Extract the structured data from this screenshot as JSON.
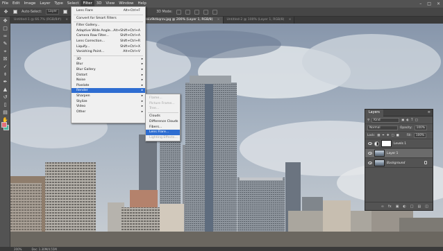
{
  "menubar": {
    "items": [
      "File",
      "Edit",
      "Image",
      "Layer",
      "Type",
      "Select",
      "Filter",
      "3D",
      "View",
      "Window",
      "Help"
    ],
    "active_index": 6
  },
  "options": {
    "auto_select_label": "Auto-Select:",
    "auto_select_value": "Layer",
    "mode_label": "3D Mode:"
  },
  "tabs": [
    {
      "label": "Untitled-1 @ 66.7% (RGB/8#)",
      "active": false
    },
    {
      "label": "Untitled-4 @ 25% (RGB/8)",
      "active": false
    },
    {
      "label": "ndh9ywyzeix9ktkqrzv.jpg @ 200% (Layer 1, RGB/8)",
      "active": true
    },
    {
      "label": "Untitled-2 @ 100% (Layer 1, RGB/8)",
      "active": false
    }
  ],
  "filter_menu": {
    "items": [
      {
        "label": "Lens Flare",
        "shortcut": "Alt+Ctrl+F",
        "sub": false
      },
      {
        "sep": true
      },
      {
        "label": "Convert for Smart Filters",
        "shortcut": "",
        "sub": false
      },
      {
        "sep": true
      },
      {
        "label": "Filter Gallery...",
        "shortcut": "",
        "sub": false
      },
      {
        "label": "Adaptive Wide Angle...",
        "shortcut": "Alt+Shift+Ctrl+A",
        "sub": false
      },
      {
        "label": "Camera Raw Filter...",
        "shortcut": "Shift+Ctrl+A",
        "sub": false
      },
      {
        "label": "Lens Correction...",
        "shortcut": "Shift+Ctrl+R",
        "sub": false
      },
      {
        "label": "Liquify...",
        "shortcut": "Shift+Ctrl+X",
        "sub": false
      },
      {
        "label": "Vanishing Point...",
        "shortcut": "Alt+Ctrl+V",
        "sub": false
      },
      {
        "sep": true
      },
      {
        "label": "3D",
        "shortcut": "",
        "sub": true
      },
      {
        "label": "Blur",
        "shortcut": "",
        "sub": true
      },
      {
        "label": "Blur Gallery",
        "shortcut": "",
        "sub": true
      },
      {
        "label": "Distort",
        "shortcut": "",
        "sub": true
      },
      {
        "label": "Noise",
        "shortcut": "",
        "sub": true
      },
      {
        "label": "Pixelate",
        "shortcut": "",
        "sub": true
      },
      {
        "label": "Render",
        "shortcut": "",
        "sub": true,
        "highlighted": true
      },
      {
        "label": "Sharpen",
        "shortcut": "",
        "sub": true
      },
      {
        "label": "Stylize",
        "shortcut": "",
        "sub": true
      },
      {
        "label": "Video",
        "shortcut": "",
        "sub": true
      },
      {
        "label": "Other",
        "shortcut": "",
        "sub": true
      }
    ]
  },
  "render_menu": {
    "items": [
      {
        "label": "Flame...",
        "disabled": true
      },
      {
        "label": "Picture Frame...",
        "disabled": true
      },
      {
        "label": "Tree...",
        "disabled": true
      },
      {
        "sep": true
      },
      {
        "label": "Clouds",
        "disabled": false
      },
      {
        "label": "Difference Clouds",
        "disabled": false
      },
      {
        "label": "Fibers...",
        "disabled": false
      },
      {
        "label": "Lens Flare...",
        "disabled": false,
        "highlighted": true
      },
      {
        "label": "Lighting Effects...",
        "disabled": true
      }
    ]
  },
  "layers_panel": {
    "title": "Layers",
    "kind_label": "Kind",
    "blend_mode": "Normal",
    "opacity_label": "Opacity:",
    "opacity_value": "100%",
    "lock_label": "Lock:",
    "fill_label": "Fill:",
    "fill_value": "100%",
    "layers": [
      {
        "name": "Levels 1",
        "type": "adjustment",
        "selected": false
      },
      {
        "name": "Layer 1",
        "type": "image",
        "selected": true
      },
      {
        "name": "Background",
        "type": "image",
        "selected": false,
        "locked": true
      }
    ]
  },
  "status": {
    "zoom": "200%",
    "doc": "Doc: 1.30M/4.55M"
  },
  "colors": {
    "foreground": "#e36f7b",
    "background": "#4cb79f",
    "highlight": "#2e6dd1"
  }
}
